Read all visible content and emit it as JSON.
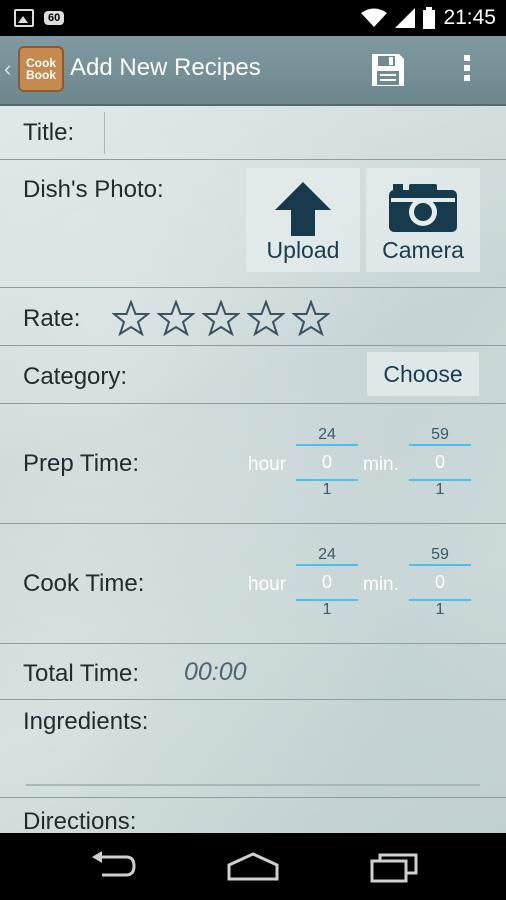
{
  "status_bar": {
    "badge": "60",
    "time": "21:45"
  },
  "action_bar": {
    "logo_line1": "Cook",
    "logo_line2": "Book",
    "title": "Add New Recipes"
  },
  "form": {
    "title_label": "Title:",
    "title_value": "",
    "photo_label": "Dish's Photo:",
    "upload_label": "Upload",
    "camera_label": "Camera",
    "rate_label": "Rate:",
    "rating": 0,
    "rating_max": 5,
    "category_label": "Category:",
    "choose_label": "Choose",
    "prep_label": "Prep Time:",
    "cook_label": "Cook Time:",
    "hour_unit": "hour",
    "min_unit": "min.",
    "prep_picker": {
      "hour_prev": "24",
      "hour_value": "0",
      "hour_next": "1",
      "min_prev": "59",
      "min_value": "0",
      "min_next": "1"
    },
    "cook_picker": {
      "hour_prev": "24",
      "hour_value": "0",
      "hour_next": "1",
      "min_prev": "59",
      "min_value": "0",
      "min_next": "1"
    },
    "total_label": "Total Time:",
    "total_value": "00:00",
    "ingredients_label": "Ingredients:",
    "directions_label": "Directions:"
  },
  "colors": {
    "action_bar": "#7f9aa0",
    "accent": "#4cc0e8",
    "button_text": "#1a3c4d"
  }
}
